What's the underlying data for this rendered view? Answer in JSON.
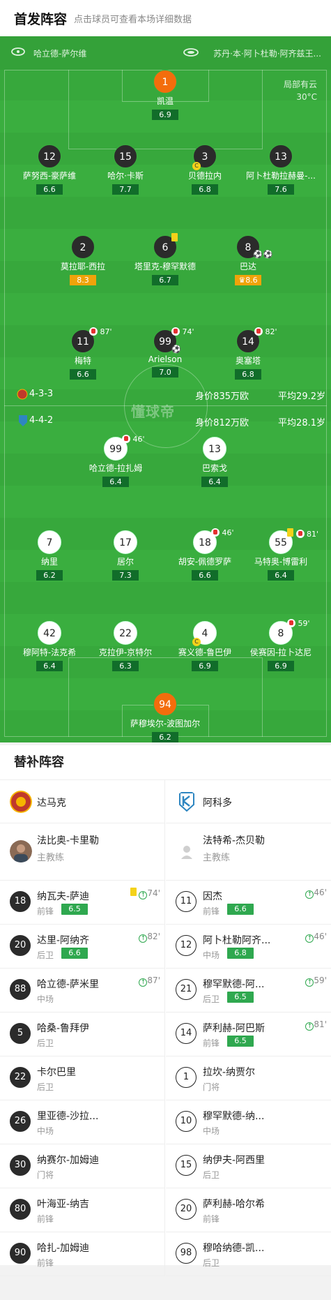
{
  "header": {
    "title": "首发阵容",
    "subtitle": "点击球员可查看本场详细数据"
  },
  "home_team": {
    "name": "哈立德-萨尔维",
    "formation": "4-3-3",
    "value": "身价835万欧",
    "avg_age": "平均29.2岁"
  },
  "away_team": {
    "name": "苏丹·本·阿卜杜勒·阿齐兹王...",
    "formation": "4-4-2",
    "value": "身价812万欧",
    "avg_age": "平均28.1岁"
  },
  "weather": {
    "condition": "局部有云",
    "temp": "30°C"
  },
  "watermark": "懂球帝",
  "home_players": [
    {
      "num": "1",
      "name": "凯温",
      "rating": "6.9",
      "gk": true
    },
    {
      "num": "12",
      "name": "萨努西-豪萨维",
      "rating": "6.6"
    },
    {
      "num": "15",
      "name": "哈尔·卡斯",
      "rating": "7.7"
    },
    {
      "num": "3",
      "name": "贝德拉内",
      "rating": "6.8",
      "captain": "C"
    },
    {
      "num": "13",
      "name": "阿卜杜勒拉赫曼-...",
      "rating": "7.6"
    },
    {
      "num": "2",
      "name": "莫拉耶-西拉",
      "rating": "8.3",
      "orange": true
    },
    {
      "num": "6",
      "name": "塔里克-穆罕默德",
      "rating": "6.7"
    },
    {
      "num": "8",
      "name": "巴达",
      "rating": "8.6",
      "orange": true,
      "star": true
    },
    {
      "num": "11",
      "name": "梅特",
      "rating": "6.6",
      "sub_time": "87'"
    },
    {
      "num": "99",
      "name": "Arielson",
      "rating": "7.0",
      "sub_time": "74'"
    },
    {
      "num": "14",
      "name": "奥塞塔",
      "rating": "6.8",
      "sub_time": "82'"
    }
  ],
  "away_players": [
    {
      "num": "99",
      "name": "哈立德-拉扎姆",
      "rating": "6.4",
      "sub_time": "46'"
    },
    {
      "num": "13",
      "name": "巴索戈",
      "rating": "6.4"
    },
    {
      "num": "7",
      "name": "纳里",
      "rating": "6.2"
    },
    {
      "num": "17",
      "name": "居尔",
      "rating": "7.3"
    },
    {
      "num": "18",
      "name": "胡安-佩德罗萨",
      "rating": "6.6",
      "sub_time": "46'"
    },
    {
      "num": "55",
      "name": "马特奥-博雷利",
      "rating": "6.4",
      "sub_time": "81'"
    },
    {
      "num": "42",
      "name": "穆阿特-法克希",
      "rating": "6.4"
    },
    {
      "num": "22",
      "name": "克拉伊-京特尔",
      "rating": "6.3"
    },
    {
      "num": "4",
      "name": "赛义德-鲁巴伊",
      "rating": "6.9",
      "captain": "C"
    },
    {
      "num": "8",
      "name": "侯赛因-拉卜达尼",
      "rating": "6.9",
      "sub_time": "59'"
    },
    {
      "num": "94",
      "name": "萨穆埃尔-波图加尔",
      "rating": "6.2",
      "gk": true
    }
  ],
  "subs": {
    "title": "替补阵容",
    "left_team": "达马克",
    "right_team": "阿科多",
    "left_coach": {
      "name": "法比奥-卡里勒",
      "role": "主教练"
    },
    "right_coach": {
      "name": "法特希-杰贝勒",
      "role": "主教练"
    },
    "left": [
      {
        "num": "18",
        "name": "纳瓦夫-萨迪",
        "pos": "前锋",
        "rating": "6.5",
        "time": "74'",
        "card": true
      },
      {
        "num": "20",
        "name": "达里-阿纳齐",
        "pos": "后卫",
        "rating": "6.6",
        "time": "82'"
      },
      {
        "num": "88",
        "name": "哈立德-萨米里",
        "pos": "中场",
        "time": "87'"
      },
      {
        "num": "5",
        "name": "哈桑-鲁拜伊",
        "pos": "后卫"
      },
      {
        "num": "22",
        "name": "卡尔巴里",
        "pos": "后卫"
      },
      {
        "num": "26",
        "name": "里亚德-沙拉...",
        "pos": "中场"
      },
      {
        "num": "30",
        "name": "纳赛尔-加姆迪",
        "pos": "门将"
      },
      {
        "num": "80",
        "name": "叶海亚-纳吉",
        "pos": "前锋"
      },
      {
        "num": "90",
        "name": "哈扎-加姆迪",
        "pos": "前锋"
      }
    ],
    "right": [
      {
        "num": "11",
        "name": "因杰",
        "pos": "前锋",
        "rating": "6.6",
        "time": "46'"
      },
      {
        "num": "12",
        "name": "阿卜杜勒阿齐...",
        "pos": "中场",
        "rating": "6.8",
        "time": "46'"
      },
      {
        "num": "21",
        "name": "穆罕默德-阿...",
        "pos": "后卫",
        "rating": "6.5",
        "time": "59'"
      },
      {
        "num": "14",
        "name": "萨利赫-阿巴斯",
        "pos": "前锋",
        "rating": "6.5",
        "time": "81'"
      },
      {
        "num": "1",
        "name": "拉坎-纳贾尔",
        "pos": "门将"
      },
      {
        "num": "10",
        "name": "穆罕默德-纳...",
        "pos": "中场"
      },
      {
        "num": "15",
        "name": "纳伊夫-阿西里",
        "pos": "后卫"
      },
      {
        "num": "20",
        "name": "萨利赫-哈尔希",
        "pos": "前锋"
      },
      {
        "num": "98",
        "name": "穆哈纳德-凯...",
        "pos": "后卫"
      }
    ]
  }
}
